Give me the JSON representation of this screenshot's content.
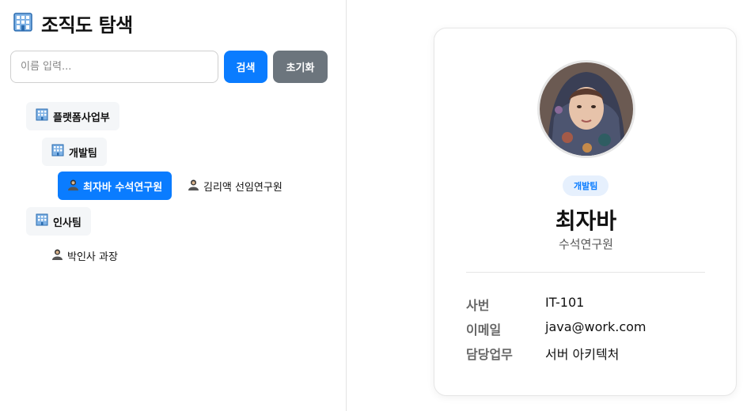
{
  "header": {
    "title": "조직도 탐색"
  },
  "search": {
    "placeholder": "이름 입력...",
    "search_label": "검색",
    "reset_label": "초기화"
  },
  "tree": {
    "dept_platform": "플랫폼사업부",
    "team_dev": "개발팀",
    "team_hr": "인사팀",
    "members": {
      "choi": "최자바 수석연구원",
      "kim": "김리액 선임연구원",
      "park": "박인사 과장"
    }
  },
  "profile": {
    "department": "개발팀",
    "name": "최자바",
    "position": "수석연구원",
    "fields": {
      "emp_id_label": "사번",
      "emp_id": "IT-101",
      "email_label": "이메일",
      "email": "java@work.com",
      "duty_label": "담당업무",
      "duty": "서버 아키텍처"
    }
  },
  "colors": {
    "accent": "#0a7cff",
    "reset": "#6c757d",
    "badge_bg": "#e6f0fd"
  }
}
